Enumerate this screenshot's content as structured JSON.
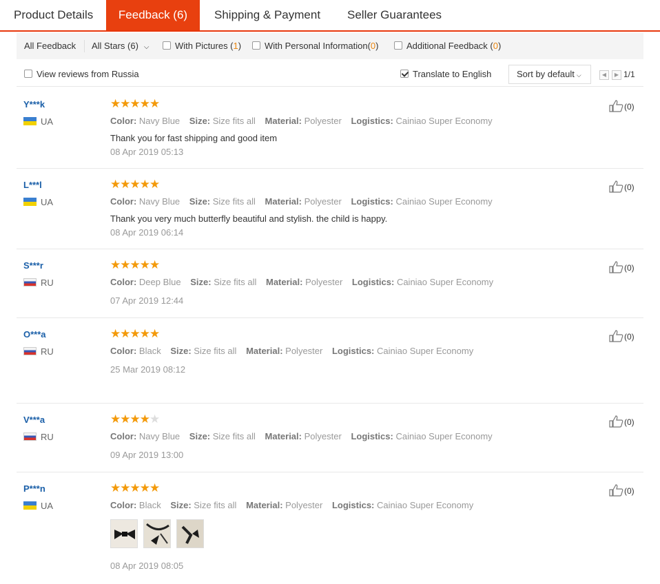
{
  "tabs": [
    {
      "label": "Product Details"
    },
    {
      "label": "Feedback (6)"
    },
    {
      "label": "Shipping & Payment"
    },
    {
      "label": "Seller Guarantees"
    }
  ],
  "filters": {
    "all_feedback": "All Feedback",
    "all_stars": "All Stars (6)",
    "with_pictures_label": "With Pictures (",
    "with_pictures_count": "1",
    "with_personal_label": "With Personal Information(",
    "with_personal_count": "0",
    "additional_label": "Additional Feedback (",
    "additional_count": "0",
    "close_paren": ")"
  },
  "options": {
    "view_russia": "View reviews from Russia",
    "translate": "Translate to English",
    "sort": "Sort by default",
    "page": "1/1"
  },
  "labels": {
    "color": "Color:",
    "size": "Size:",
    "material": "Material:",
    "logistics": "Logistics:"
  },
  "colors": {
    "accent": "#e8400f",
    "star": "#f39a0b",
    "username": "#1a5fa8"
  },
  "reviews": [
    {
      "user": "Y***k",
      "country": "UA",
      "rating": 5,
      "color": "Navy Blue",
      "size": "Size fits all",
      "material": "Polyester",
      "logistics": "Cainiao Super Economy",
      "text": "Thank you for fast shipping and good item",
      "date": "08 Apr 2019 05:13",
      "likes": "(0)"
    },
    {
      "user": "L***l",
      "country": "UA",
      "rating": 5,
      "color": "Navy Blue",
      "size": "Size fits all",
      "material": "Polyester",
      "logistics": "Cainiao Super Economy",
      "text": "Thank you very much butterfly beautiful and stylish. the child is happy.",
      "date": "08 Apr 2019 06:14",
      "likes": "(0)"
    },
    {
      "user": "S***r",
      "country": "RU",
      "rating": 5,
      "color": "Deep Blue",
      "size": "Size fits all",
      "material": "Polyester",
      "logistics": "Cainiao Super Economy",
      "text": "",
      "date": "07 Apr 2019 12:44",
      "likes": "(0)"
    },
    {
      "user": "O***a",
      "country": "RU",
      "rating": 5,
      "color": "Black",
      "size": "Size fits all",
      "material": "Polyester",
      "logistics": "Cainiao Super Economy",
      "text": "",
      "date": "25 Mar 2019 08:12",
      "likes": "(0)"
    },
    {
      "user": "V***a",
      "country": "RU",
      "rating": 4,
      "color": "Navy Blue",
      "size": "Size fits all",
      "material": "Polyester",
      "logistics": "Cainiao Super Economy",
      "text": "",
      "date": "09 Apr 2019 13:00",
      "likes": "(0)"
    },
    {
      "user": "P***n",
      "country": "UA",
      "rating": 5,
      "color": "Black",
      "size": "Size fits all",
      "material": "Polyester",
      "logistics": "Cainiao Super Economy",
      "text": "",
      "date": "08 Apr 2019 08:05",
      "likes": "(0)",
      "photos": 3
    }
  ]
}
